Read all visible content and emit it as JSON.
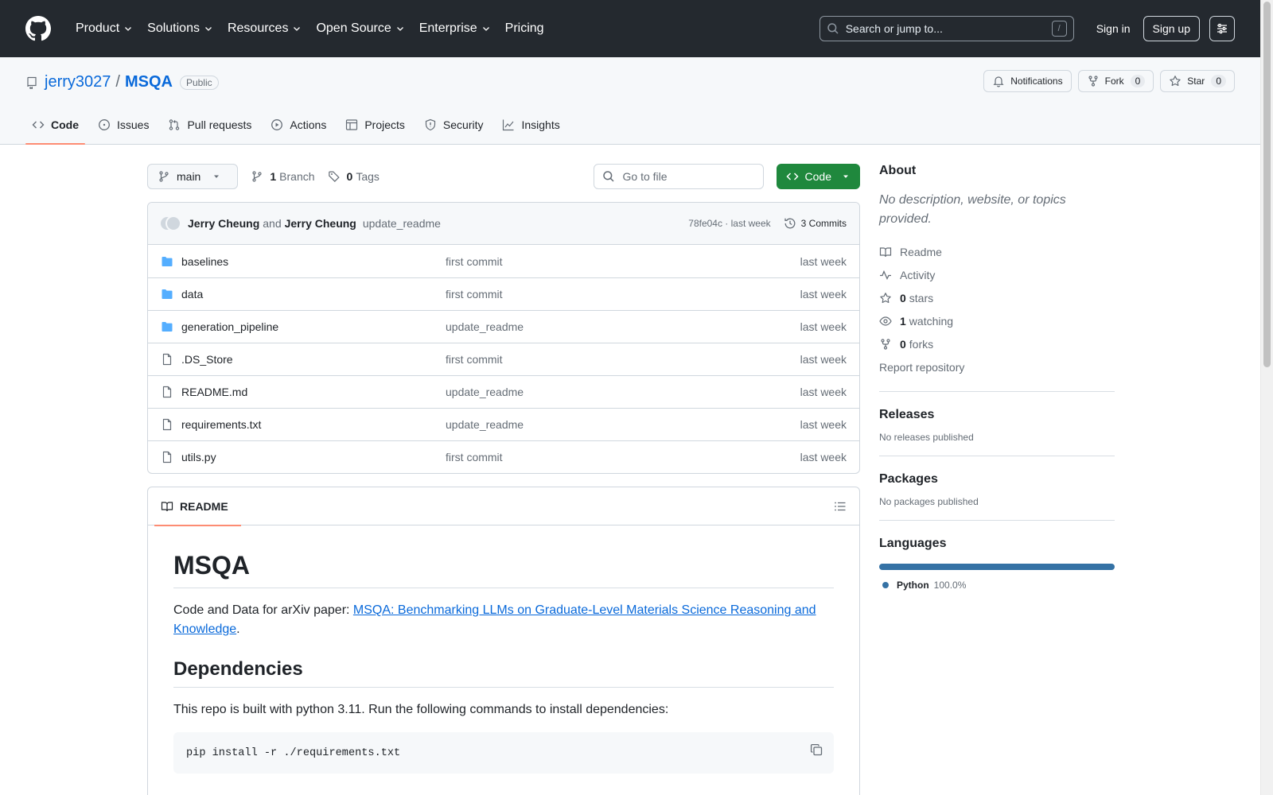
{
  "header": {
    "nav": [
      "Product",
      "Solutions",
      "Resources",
      "Open Source",
      "Enterprise",
      "Pricing"
    ],
    "search_placeholder": "Search or jump to...",
    "search_key": "/",
    "signin": "Sign in",
    "signup": "Sign up"
  },
  "repo": {
    "owner": "jerry3027",
    "separator": "/",
    "name": "MSQA",
    "visibility": "Public",
    "notifications_label": "Notifications",
    "fork_label": "Fork",
    "fork_count": "0",
    "star_label": "Star",
    "star_count": "0",
    "tabs": [
      "Code",
      "Issues",
      "Pull requests",
      "Actions",
      "Projects",
      "Security",
      "Insights"
    ]
  },
  "toolbar": {
    "branch": "main",
    "branch_count": "1",
    "branch_label": "Branch",
    "tag_count": "0",
    "tag_label": "Tags",
    "goto_placeholder": "Go to file",
    "code_label": "Code"
  },
  "commit": {
    "author1": "Jerry Cheung",
    "and": "and",
    "author2": "Jerry Cheung",
    "message": "update_readme",
    "sha_time": "78fe04c · last week",
    "commits": "3 Commits"
  },
  "files": [
    {
      "type": "folder",
      "name": "baselines",
      "message": "first commit",
      "date": "last week"
    },
    {
      "type": "folder",
      "name": "data",
      "message": "first commit",
      "date": "last week"
    },
    {
      "type": "folder",
      "name": "generation_pipeline",
      "message": "update_readme",
      "date": "last week"
    },
    {
      "type": "file",
      "name": ".DS_Store",
      "message": "first commit",
      "date": "last week"
    },
    {
      "type": "file",
      "name": "README.md",
      "message": "update_readme",
      "date": "last week"
    },
    {
      "type": "file",
      "name": "requirements.txt",
      "message": "update_readme",
      "date": "last week"
    },
    {
      "type": "file",
      "name": "utils.py",
      "message": "first commit",
      "date": "last week"
    }
  ],
  "readme": {
    "tab_label": "README",
    "title": "MSQA",
    "intro_prefix": "Code and Data for arXiv paper: ",
    "intro_link": "MSQA: Benchmarking LLMs on Graduate-Level Materials Science Reasoning and Knowledge",
    "intro_suffix": ".",
    "deps_heading": "Dependencies",
    "deps_text": "This repo is built with python 3.11. Run the following commands to install dependencies:",
    "code": "pip install -r ./requirements.txt"
  },
  "sidebar": {
    "about_heading": "About",
    "about_desc": "No description, website, or topics provided.",
    "readme": "Readme",
    "activity": "Activity",
    "stars_count": "0",
    "stars_label": "stars",
    "watching_count": "1",
    "watching_label": "watching",
    "forks_count": "0",
    "forks_label": "forks",
    "report": "Report repository",
    "releases_heading": "Releases",
    "releases_text": "No releases published",
    "packages_heading": "Packages",
    "packages_text": "No packages published",
    "languages_heading": "Languages",
    "language_name": "Python",
    "language_pct": "100.0%",
    "language_color": "#3572A5"
  }
}
